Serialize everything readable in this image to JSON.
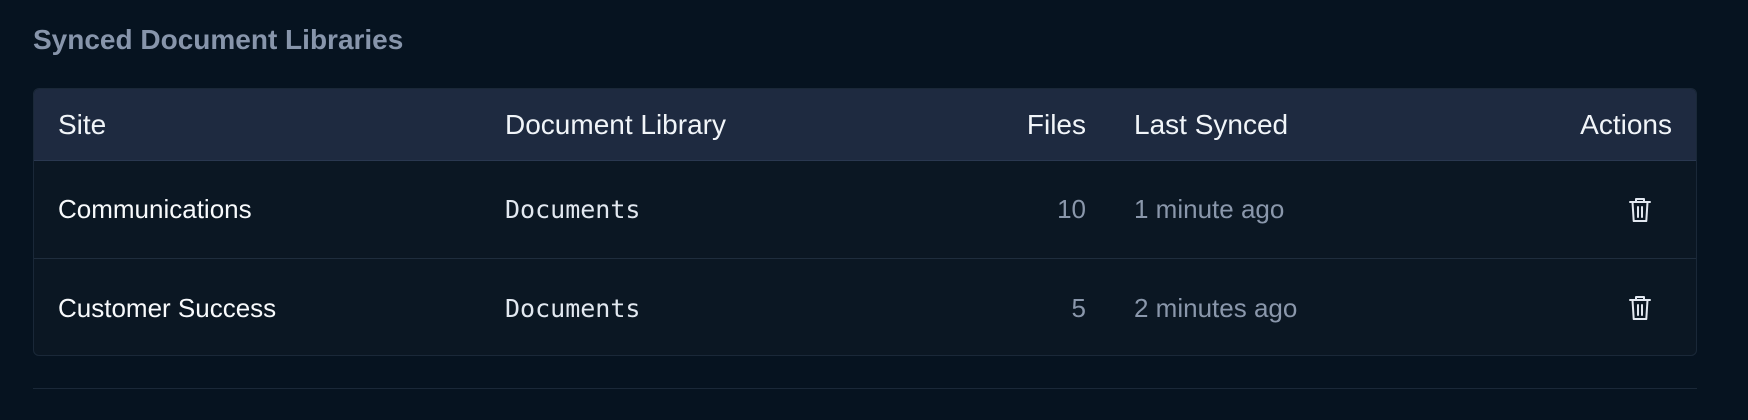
{
  "section": {
    "title": "Synced Document Libraries"
  },
  "table": {
    "columns": {
      "site": "Site",
      "library": "Document Library",
      "files": "Files",
      "last_synced": "Last Synced",
      "actions": "Actions"
    },
    "rows": [
      {
        "site": "Communications",
        "library": "Documents",
        "files": "10",
        "last_synced": "1 minute ago",
        "action_icon": "trash-icon"
      },
      {
        "site": "Customer Success",
        "library": "Documents",
        "files": "5",
        "last_synced": "2 minutes ago",
        "action_icon": "trash-icon"
      }
    ]
  },
  "colors": {
    "background": "#061320",
    "card": "#0b1723",
    "header": "#1e2a40",
    "muted_text": "#8a97ab"
  }
}
